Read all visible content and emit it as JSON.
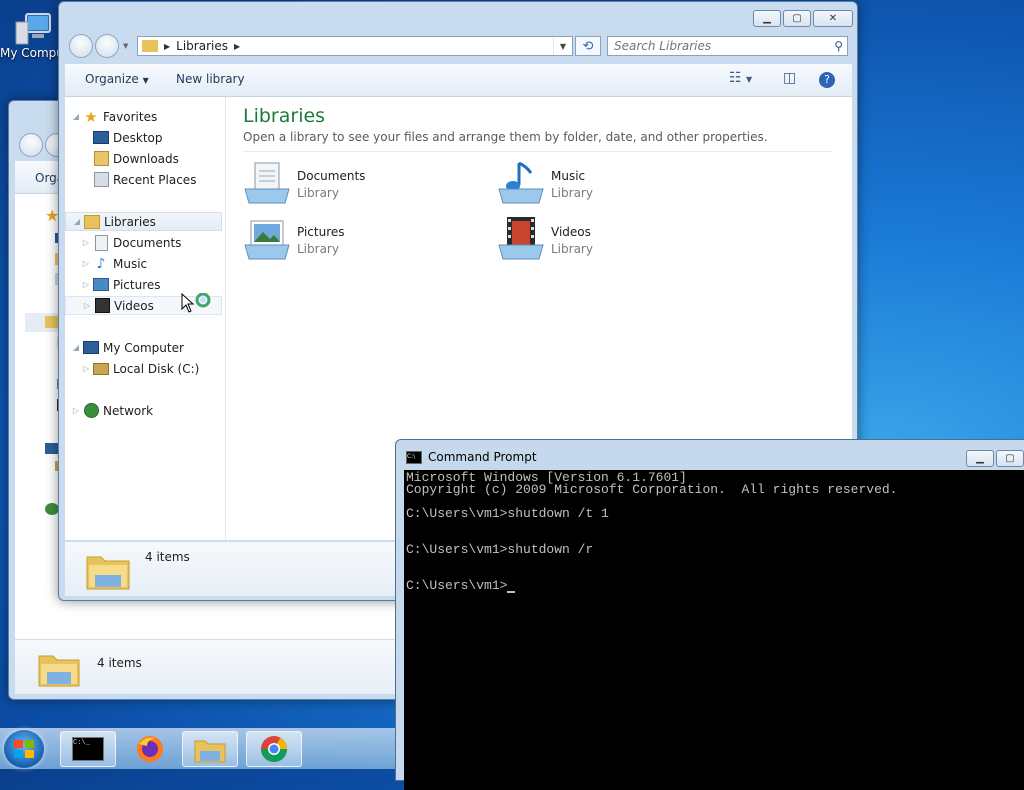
{
  "desktop": {
    "icon_label": "My Computer"
  },
  "back_explorer": {
    "toolbar_label": "Orga",
    "status": "4 items"
  },
  "explorer": {
    "path_item": "Libraries",
    "search_placeholder": "Search Libraries",
    "toolbar": {
      "organize": "Organize",
      "new_library": "New library"
    },
    "nav": {
      "favorites": "Favorites",
      "desktop": "Desktop",
      "downloads": "Downloads",
      "recent_places": "Recent Places",
      "libraries": "Libraries",
      "documents": "Documents",
      "music": "Music",
      "pictures": "Pictures",
      "videos": "Videos",
      "my_computer": "My Computer",
      "local_disk": "Local Disk (C:)",
      "network": "Network"
    },
    "title": "Libraries",
    "subtitle": "Open a library to see your files and arrange them by folder, date, and other properties.",
    "libraries": [
      {
        "name": "Documents",
        "kind": "Library"
      },
      {
        "name": "Music",
        "kind": "Library"
      },
      {
        "name": "Pictures",
        "kind": "Library"
      },
      {
        "name": "Videos",
        "kind": "Library"
      }
    ],
    "status": "4 items"
  },
  "cmd": {
    "title": "Command Prompt",
    "lines": [
      "Microsoft Windows [Version 6.1.7601]",
      "Copyright (c) 2009 Microsoft Corporation.  All rights reserved.",
      "",
      "C:\\Users\\vm1>shutdown /t 1",
      "",
      "",
      "C:\\Users\\vm1>shutdown /r",
      "",
      "",
      "C:\\Users\\vm1>"
    ]
  },
  "colors": {
    "title_green": "#1e7a3c",
    "desktop_blue": "#1a7ad6"
  }
}
